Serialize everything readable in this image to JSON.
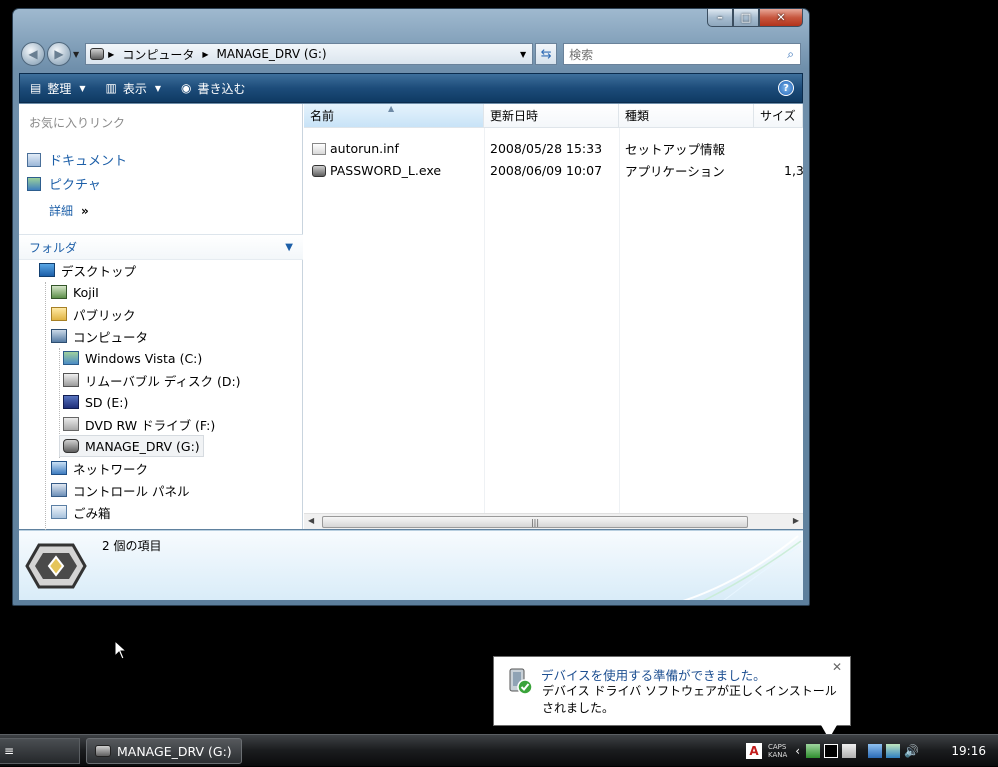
{
  "window": {
    "address_segments": [
      "コンピュータ",
      "MANAGE_DRV (G:)"
    ],
    "search_placeholder": "検索"
  },
  "toolbar": {
    "organize": "整理",
    "view": "表示",
    "burn": "書き込む"
  },
  "nav": {
    "favorites_title": "お気に入りリンク",
    "favorites": [
      "ドキュメント",
      "ピクチャ"
    ],
    "more": "詳細",
    "folders_title": "フォルダ",
    "tree": {
      "desktop": "デスクトップ",
      "user": "KojiI",
      "public": "パブリック",
      "computer": "コンピュータ",
      "c_drive": "Windows Vista (C:)",
      "d_drive": "リムーバブル ディスク (D:)",
      "e_drive": "SD (E:)",
      "f_drive": "DVD RW ドライブ (F:)",
      "g_drive": "MANAGE_DRV (G:)",
      "network": "ネットワーク",
      "control_panel": "コントロール パネル",
      "recycle_bin": "ごみ箱"
    }
  },
  "files": {
    "columns": [
      "名前",
      "更新日時",
      "種類",
      "サイズ"
    ],
    "rows": [
      {
        "name": "autorun.inf",
        "date": "2008/05/28 15:33",
        "type": "セットアップ情報",
        "size": ""
      },
      {
        "name": "PASSWORD_L.exe",
        "date": "2008/06/09 10:07",
        "type": "アプリケーション",
        "size": "1,3"
      }
    ]
  },
  "details": {
    "item_count": "2 個の項目"
  },
  "balloon": {
    "title": "デバイスを使用する準備ができました。",
    "body": "デバイス ドライバ ソフトウェアが正しくインストールされました。"
  },
  "taskbar": {
    "task_label": "MANAGE_DRV (G:)",
    "caps": "CAPS",
    "kana": "KANA",
    "clock": "19:16"
  },
  "colors": {
    "toolbar": "#1d4c7a",
    "link": "#1d5fa8"
  }
}
